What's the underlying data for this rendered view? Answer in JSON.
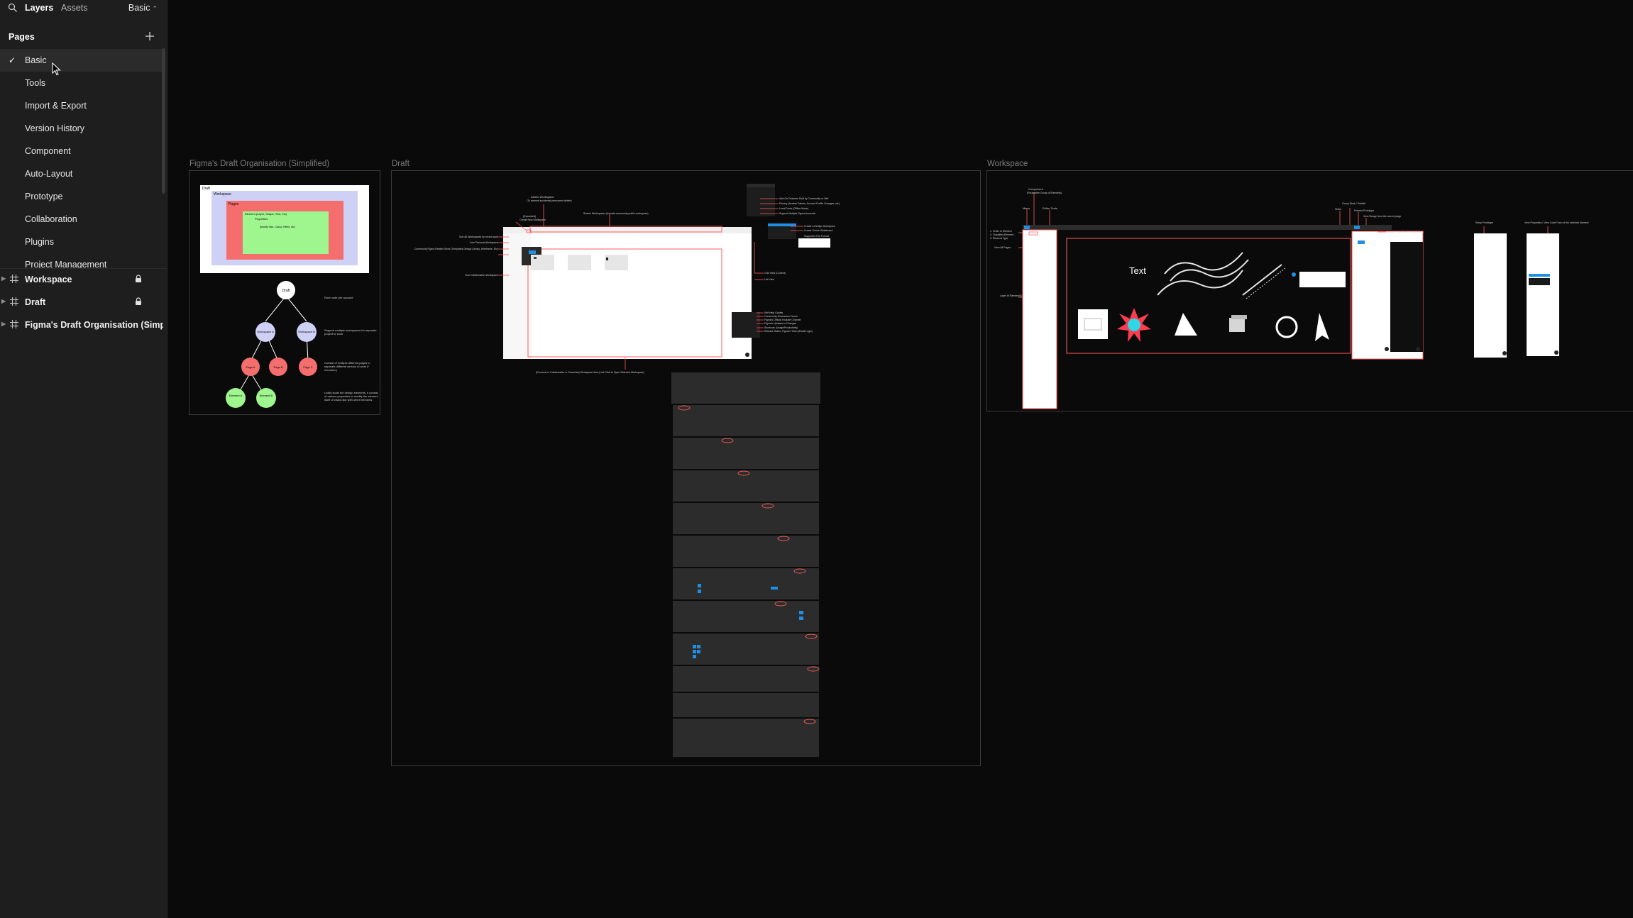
{
  "sidebar": {
    "tabs": {
      "layers": "Layers",
      "assets": "Assets"
    },
    "current_page_select": "Basic",
    "pages_header": "Pages",
    "pages": [
      {
        "label": "Basic",
        "selected": true
      },
      {
        "label": "Tools"
      },
      {
        "label": "Import & Export"
      },
      {
        "label": "Version History"
      },
      {
        "label": "Component"
      },
      {
        "label": "Auto-Layout"
      },
      {
        "label": "Prototype"
      },
      {
        "label": "Collaboration"
      },
      {
        "label": "Plugins"
      },
      {
        "label": "Project Management"
      }
    ],
    "layers": [
      {
        "label": "Workspace",
        "locked": true
      },
      {
        "label": "Draft",
        "locked": true
      },
      {
        "label": "Figma's Draft Organisation (Simpli...",
        "locked": false
      }
    ]
  },
  "canvas": {
    "frames": {
      "organisation": {
        "label": "Figma's Draft Organisation (Simplified)",
        "box_labels": {
          "outer": "Draft",
          "workspace": "Workspace",
          "page": "Pages",
          "element": "Element (Layer, Shape, Text, etc)",
          "properties": "Properties",
          "properties_note": "(Modify Size, Colour, Effect, etc)"
        },
        "tree_root": "Draft",
        "tree_workspaces": [
          "Workspace A",
          "Workspace B"
        ],
        "tree_pages": [
          "Page A",
          "Page B",
          "Page C"
        ],
        "tree_elements": [
          "Element A",
          "Element B"
        ],
        "notes": [
          "Root node per account",
          "Support multiple workspaces for separate project or work",
          "Consist of multiple different pages to separate different version of work (* recursion)",
          "Lastly scale the design elements, it consist of various properties to modify the element itself of chaos like with other elements"
        ]
      },
      "draft": {
        "label": "Draft",
        "annotations": {
          "delete_workspace": "Delete Workspace",
          "delete_workspace_note": "(To prevent accidental permanent delete)",
          "expanded": "(Expanded)",
          "create_new_workspace": "Create New Workspace",
          "search_workspaces": "Search Workspaces (Include community public workspace)",
          "sort_all_workspaces": "Sort All Workspaces by recent work",
          "personal_workspace": "Your Personal Workspace",
          "community_templates": "Community Figma Related Work (Templates Design Library, Wireframe, Etc)",
          "collaboration_workspace": "Your Collaboration Workspace",
          "add_features": "Add-On Features Sold by Community or Self",
          "privacy_settings": "Privacy (Access Tokens, Account Profile Changes, etc)",
          "local_fonts": "Local Fonts (Offline Mode)",
          "multiple_accounts": "Support Multiple Figma Accounts",
          "create_design": "Create a Design Workspace",
          "create_whiteboard": "Create Online Whiteboard",
          "supported_formats": "Supported File Format",
          "grid_view": "Grid View (Current)",
          "list_view": "List View",
          "help": "Self Help Guides",
          "community": "Community Discussion Forum",
          "youtube": "Figma's Official Youtube Channel",
          "updates": "Figma's Updates to Changes",
          "shortcuts": "Shortcuts (Usage/Productivity)",
          "release_notes": "Release Notes, Figma's Team (Email Login)",
          "bottom_note": "(Personal or Collaborative or Searched) Workspace Area (Left-Click to Open Selected Workspace)"
        }
      },
      "workspace": {
        "label": "Workspace",
        "annotations": {
          "component": "Component",
          "component_note": "(Reuseable Group of Elements)",
          "menu": "Menu",
          "editor_tools": "Editor Tools",
          "share": "Share",
          "group_work": "Group Work / Publish",
          "present": "Present Prototype",
          "view_range": "View Range from the current page",
          "design_properties": "Design Properties (Configuration)",
          "setup_prototype": "Setup Prototype",
          "view_properties": "View Properties / View Code Form of the selected element",
          "order_of_element": "1. Order of Element",
          "classified_element": "2. Classified Element",
          "element_type": "3. Element Type",
          "view_all_pages": "View All Pages",
          "layers_of_elements": "Layer of Element(s)",
          "sample_text": "Text"
        }
      }
    }
  },
  "colors": {
    "accent_red": "#e05a5a",
    "outline_red": "#ff5b5b",
    "lavender": "#cfd0f6",
    "salmon": "#f56e6e",
    "light_green": "#9ff58e",
    "figma_blue": "#1f8fe3",
    "cyan": "#2fd6e6"
  }
}
